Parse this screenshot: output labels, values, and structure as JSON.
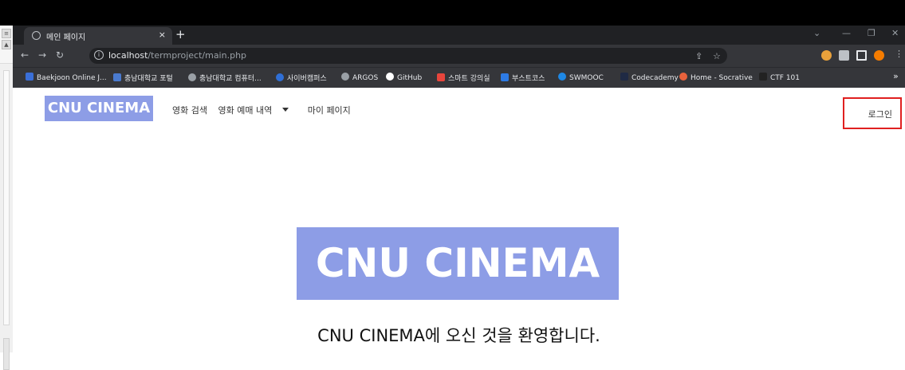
{
  "browser": {
    "tab_title": "메인 페이지",
    "tab_close": "×",
    "new_tab": "+",
    "url_host": "localhost",
    "url_path": "/termproject/main.php",
    "bookmarks": [
      {
        "label": "Baekjoon Online J...",
        "color": "#3a6fd8"
      },
      {
        "label": "충남대학교 포털",
        "color": "#4a7bd0"
      },
      {
        "label": "충남대학교 컴퓨터...",
        "color": "#9aa0a6"
      },
      {
        "label": "사이버캠퍼스",
        "color": "#2f6fd6"
      },
      {
        "label": "ARGOS",
        "color": "#9aa0a6"
      },
      {
        "label": "GitHub",
        "color": "#ffffff"
      },
      {
        "label": "스마트 강의실",
        "color": "#e8453c"
      },
      {
        "label": "부스트코스",
        "color": "#2d7be5"
      },
      {
        "label": "SWMOOC",
        "color": "#1e88e5"
      },
      {
        "label": "Codecademy",
        "color": "#1f2a44"
      },
      {
        "label": "Home - Socrative",
        "color": "#e8623c"
      },
      {
        "label": "CTF 101",
        "color": "#222222"
      }
    ],
    "more_bookmarks": "»"
  },
  "site": {
    "brand": "CNU CINEMA",
    "nav": {
      "search": "영화 검색",
      "reservations": "영화 예매 내역",
      "mypage": "마이 페이지"
    },
    "login": "로그인",
    "hero": "CNU CINEMA",
    "welcome": "CNU CINEMA에 오신 것을 환영합니다."
  },
  "colors": {
    "brand_bg": "#8d9de6",
    "highlight": "#e02020"
  }
}
